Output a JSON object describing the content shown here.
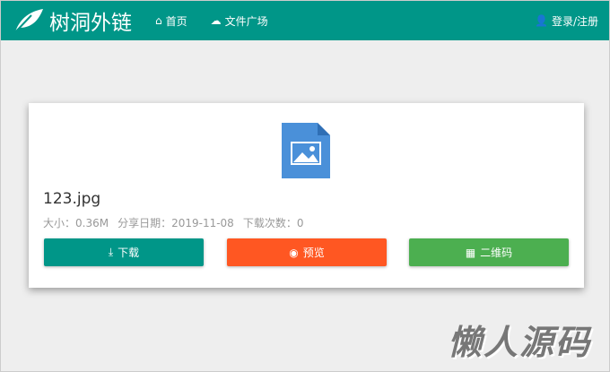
{
  "nav": {
    "brand": "树洞外链",
    "home": "首页",
    "files": "文件广场",
    "login": "登录/注册"
  },
  "file": {
    "name": "123.jpg",
    "size": "大小：0.36M",
    "date": "分享日期：2019-11-08",
    "downloads": "下载次数：0"
  },
  "buttons": {
    "download": "下载",
    "preview": "预览",
    "qrcode": "二维码"
  },
  "colors": {
    "primary": "#009688",
    "preview": "#FF5722",
    "qrcode": "#4CAF50"
  },
  "watermark": "懒人源码"
}
